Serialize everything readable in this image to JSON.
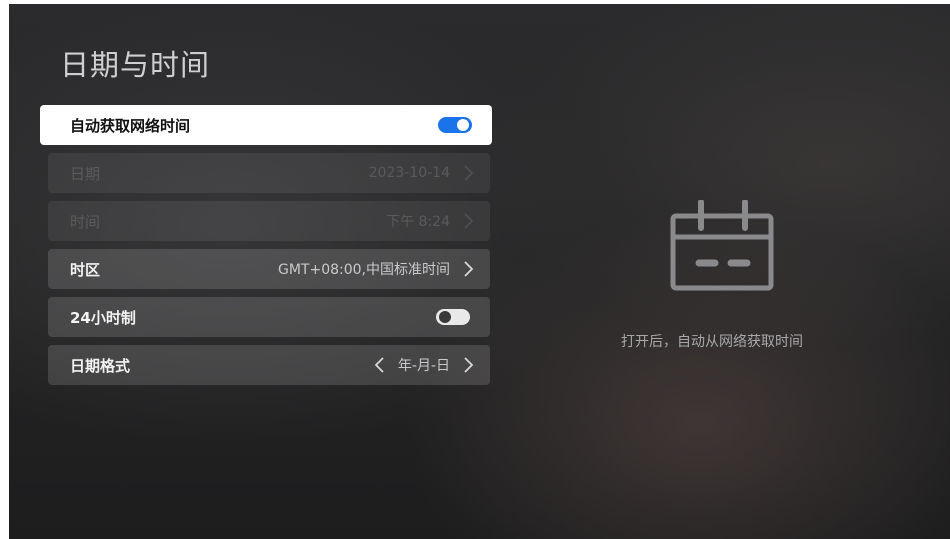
{
  "page": {
    "title": "日期与时间"
  },
  "settings": {
    "auto_network_time": {
      "label": "自动获取网络时间",
      "enabled": true
    },
    "date": {
      "label": "日期",
      "value": "2023-10-14",
      "disabled": true
    },
    "time": {
      "label": "时间",
      "value": "下午 8:24",
      "disabled": true
    },
    "timezone": {
      "label": "时区",
      "value": "GMT+08:00,中国标准时间"
    },
    "hour24": {
      "label": "24小时制",
      "enabled": false
    },
    "date_format": {
      "label": "日期格式",
      "value": "年-月-日"
    }
  },
  "hint": {
    "icon": "calendar-icon",
    "text": "打开后，自动从网络获取时间"
  },
  "colors": {
    "accent": "#1a73e8",
    "focus_background": "#ffffff",
    "row_background": "rgba(255,255,255,0.14)"
  }
}
